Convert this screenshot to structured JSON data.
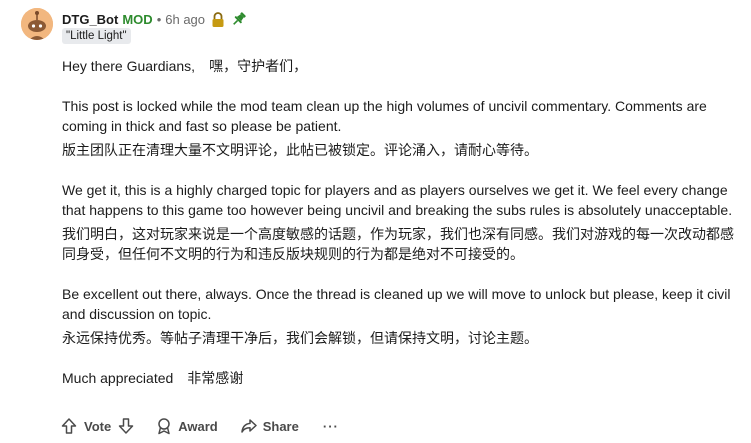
{
  "comment": {
    "author": "DTG_Bot",
    "mod_badge": "MOD",
    "separator": "•",
    "time": "6h ago",
    "flair": "\"Little Light\"",
    "status_icons": [
      "lock-icon",
      "pin-icon"
    ],
    "colors": {
      "mod": "#2e8b2e",
      "lock": "#c69a12",
      "pin": "#2e8b2e",
      "avatar": "#f2b77f"
    },
    "paragraphs": [
      "Hey there Guardians,　嘿，守护者们，",
      "This post is locked while the mod team clean up the high volumes of uncivil commentary. Comments are coming in thick and fast so please be patient.",
      "版主团队正在清理大量不文明评论，此帖已被锁定。评论涌入，请耐心等待。",
      "We get it, this is a highly charged topic for players and as players ourselves we get it. We feel every change that happens to this game too however being uncivil and breaking the subs rules is absolutely unacceptable.",
      "我们明白，这对玩家来说是一个高度敏感的话题，作为玩家，我们也深有同感。我们对游戏的每一次改动都感同身受，但任何不文明的行为和违反版块规则的行为都是绝对不可接受的。",
      "Be excellent out there, always. Once the thread is cleaned up we will move to unlock but please, keep it civil and discussion on topic.",
      "永远保持优秀。等帖子清理干净后，我们会解锁，但请保持文明，讨论主题。",
      "Much appreciated　非常感谢"
    ]
  },
  "actions": {
    "vote": "Vote",
    "award": "Award",
    "share": "Share",
    "more": "···"
  }
}
